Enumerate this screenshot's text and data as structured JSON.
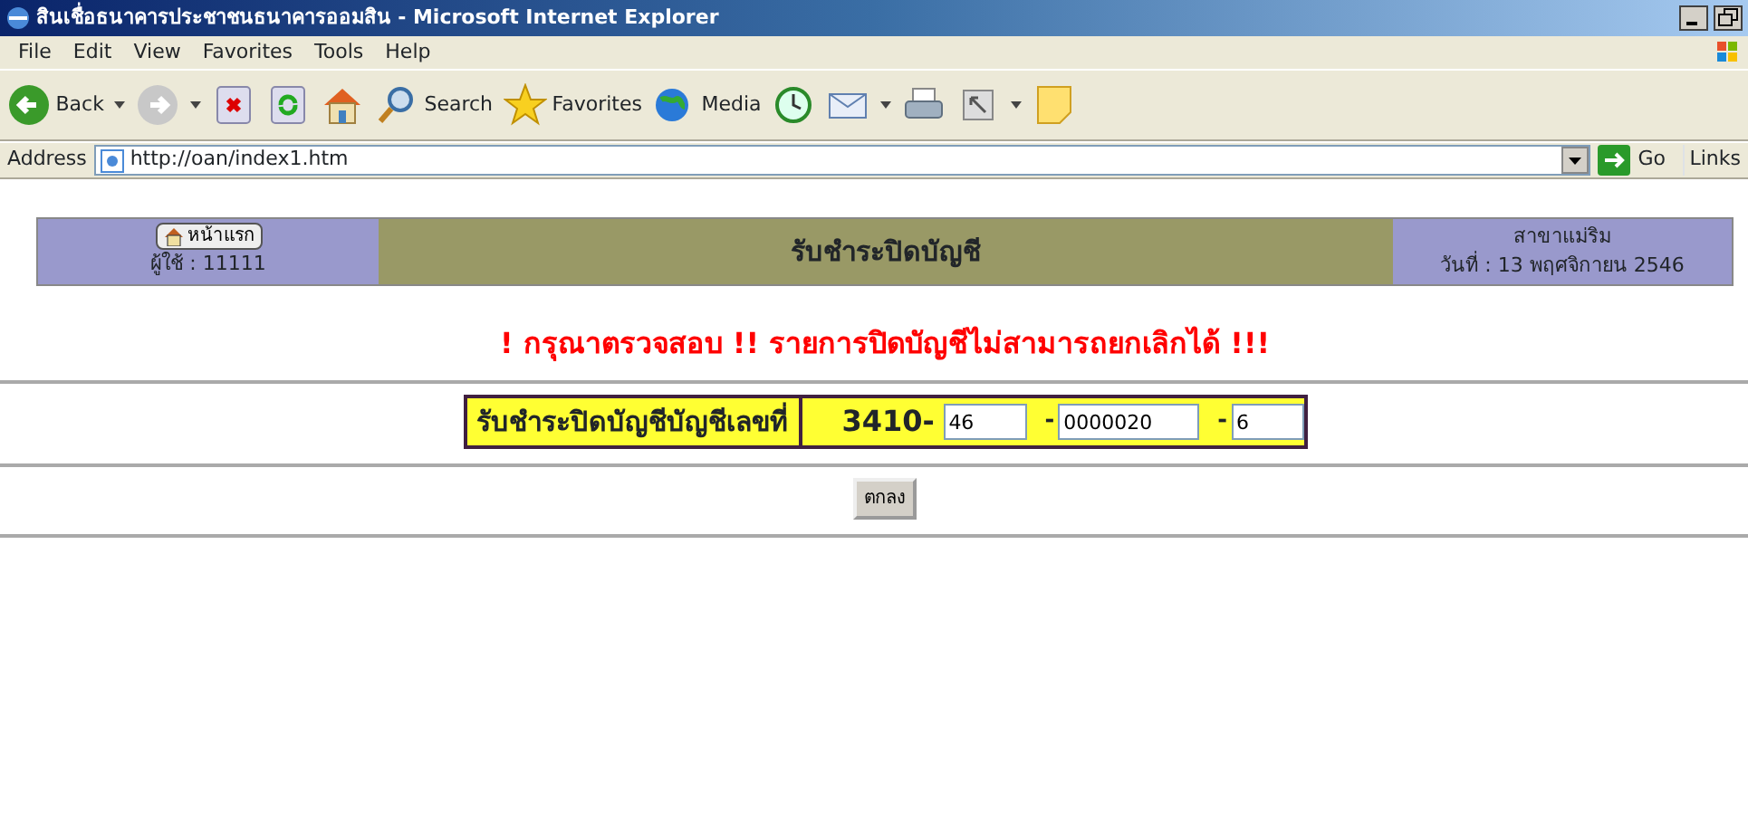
{
  "window": {
    "title": "สินเชื่อธนาคารประชาชนธนาคารออมสิน - Microsoft Internet Explorer"
  },
  "menu": [
    "File",
    "Edit",
    "View",
    "Favorites",
    "Tools",
    "Help"
  ],
  "toolbar": [
    {
      "kind": "back",
      "label": "Back"
    },
    {
      "kind": "forward"
    },
    {
      "kind": "stop"
    },
    {
      "kind": "refresh"
    },
    {
      "kind": "home"
    },
    {
      "kind": "search",
      "label": "Search"
    },
    {
      "kind": "favorites",
      "label": "Favorites"
    },
    {
      "kind": "media",
      "label": "Media"
    },
    {
      "kind": "history"
    },
    {
      "kind": "mail"
    },
    {
      "kind": "print"
    },
    {
      "kind": "edit"
    },
    {
      "kind": "note"
    }
  ],
  "address": {
    "label": "Address",
    "value": "http://oan/index1.htm",
    "go": "Go",
    "links": "Links"
  },
  "page": {
    "home_button": "หน้าแรก",
    "user": "ผู้ใช้ : 11111",
    "heading": "รับชำระปิดบัญชี",
    "branch": "สาขาแม่ริม",
    "date": "วันที่ : 13 พฤศจิกายน 2546",
    "warning": "! กรุณาตรวจสอบ !! รายการปิดบัญชีไม่สามารถยกเลิกได้ !!!",
    "account_label": "รับชำระปิดบัญชีบัญชีเลขที่",
    "account_prefix": "3410-",
    "fields": [
      {
        "value": "46"
      },
      {
        "separator": "-",
        "value": "0000020"
      },
      {
        "separator": "-",
        "value": "6"
      }
    ],
    "submit": "ตกลง"
  }
}
